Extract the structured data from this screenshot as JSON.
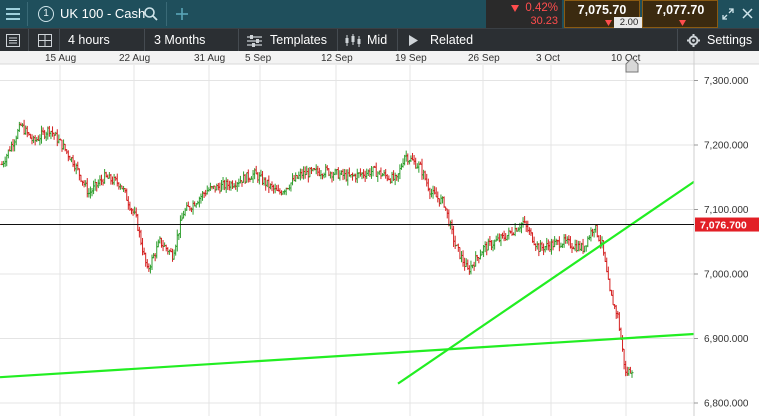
{
  "topbar": {
    "menu_icon": "hamburger-icon",
    "window_number": "1",
    "instrument": "UK 100 - Cash",
    "search_icon": "search-icon",
    "add_icon": "plus-icon",
    "change_pct": "0.42%",
    "change_pts": "30.23",
    "sell_price": "7,075.70",
    "spread": "2.00",
    "buy_price": "7,077.70",
    "expand_icon": "expand-icon",
    "close_icon": "close-icon"
  },
  "toolbar": {
    "list_icon": "list-icon",
    "layout_icon": "grid-layout-icon",
    "interval": "4 hours",
    "range": "3 Months",
    "templates": "Templates",
    "mid": "Mid",
    "related": "Related",
    "settings": "Settings"
  },
  "colors": {
    "topbar_bg": "#1f4f5c",
    "toolbar_bg": "#2b2f33",
    "up": "#2e9e2e",
    "down": "#d42020",
    "trendline": "#22ee22",
    "price_label_bg": "#e21f26",
    "change_down": "#ff4d4d"
  },
  "chart_data": {
    "type": "ohlc",
    "title": "",
    "xlabel": "",
    "ylabel": "",
    "ylim": [
      6790,
      7325
    ],
    "y_ticks": [
      6800,
      6900,
      7000,
      7100,
      7200,
      7300
    ],
    "y_tick_labels": [
      "6,800.000",
      "6,900.000",
      "7,000.000",
      "7,100.000",
      "7,200.000",
      "7,300.000"
    ],
    "x_tick_labels": [
      "15 Aug",
      "22 Aug",
      "31 Aug",
      "5 Sep",
      "12 Sep",
      "19 Sep",
      "26 Sep",
      "3 Oct",
      "10 Oct"
    ],
    "current_price": 7076.7,
    "current_price_label": "7,076.700",
    "grid": true,
    "bar_count": 400,
    "price_path": [
      [
        0,
        7170
      ],
      [
        6,
        7200
      ],
      [
        12,
        7230
      ],
      [
        20,
        7205
      ],
      [
        30,
        7225
      ],
      [
        38,
        7200
      ],
      [
        45,
        7175
      ],
      [
        55,
        7125
      ],
      [
        65,
        7150
      ],
      [
        75,
        7140
      ],
      [
        85,
        7085
      ],
      [
        92,
        7005
      ],
      [
        100,
        7050
      ],
      [
        108,
        7030
      ],
      [
        115,
        7095
      ],
      [
        130,
        7130
      ],
      [
        145,
        7140
      ],
      [
        160,
        7155
      ],
      [
        175,
        7125
      ],
      [
        190,
        7155
      ],
      [
        205,
        7160
      ],
      [
        220,
        7150
      ],
      [
        235,
        7160
      ],
      [
        250,
        7145
      ],
      [
        255,
        7185
      ],
      [
        265,
        7165
      ],
      [
        272,
        7125
      ],
      [
        280,
        7110
      ],
      [
        287,
        7045
      ],
      [
        295,
        7005
      ],
      [
        305,
        7040
      ],
      [
        320,
        7060
      ],
      [
        330,
        7080
      ],
      [
        340,
        7040
      ],
      [
        355,
        7050
      ],
      [
        368,
        7040
      ],
      [
        375,
        7075
      ],
      [
        380,
        7045
      ],
      [
        385,
        6970
      ],
      [
        390,
        6935
      ],
      [
        395,
        6845
      ],
      [
        402,
        6860
      ],
      [
        408,
        6930
      ],
      [
        415,
        6970
      ],
      [
        422,
        7020
      ],
      [
        430,
        7085
      ],
      [
        440,
        7110
      ],
      [
        450,
        7075
      ],
      [
        460,
        7090
      ],
      [
        472,
        7070
      ],
      [
        482,
        7040
      ],
      [
        490,
        7065
      ],
      [
        500,
        7090
      ],
      [
        510,
        7135
      ],
      [
        520,
        7090
      ],
      [
        530,
        7030
      ],
      [
        540,
        7065
      ],
      [
        548,
        7020
      ],
      [
        556,
        7050
      ],
      [
        564,
        7030
      ],
      [
        572,
        6970
      ],
      [
        578,
        7040
      ],
      [
        585,
        7080
      ],
      [
        593,
        7060
      ],
      [
        602,
        7090
      ],
      [
        610,
        7070
      ],
      [
        616,
        7115
      ],
      [
        621,
        7135
      ],
      [
        626,
        7100
      ],
      [
        630,
        7076
      ]
    ],
    "trendlines": [
      {
        "from": [
          "x0",
          6840
        ],
        "to": [
          "right",
          6907
        ]
      },
      {
        "from": [
          "19 Sep",
          6830
        ],
        "to": [
          "right",
          7143
        ]
      }
    ]
  }
}
